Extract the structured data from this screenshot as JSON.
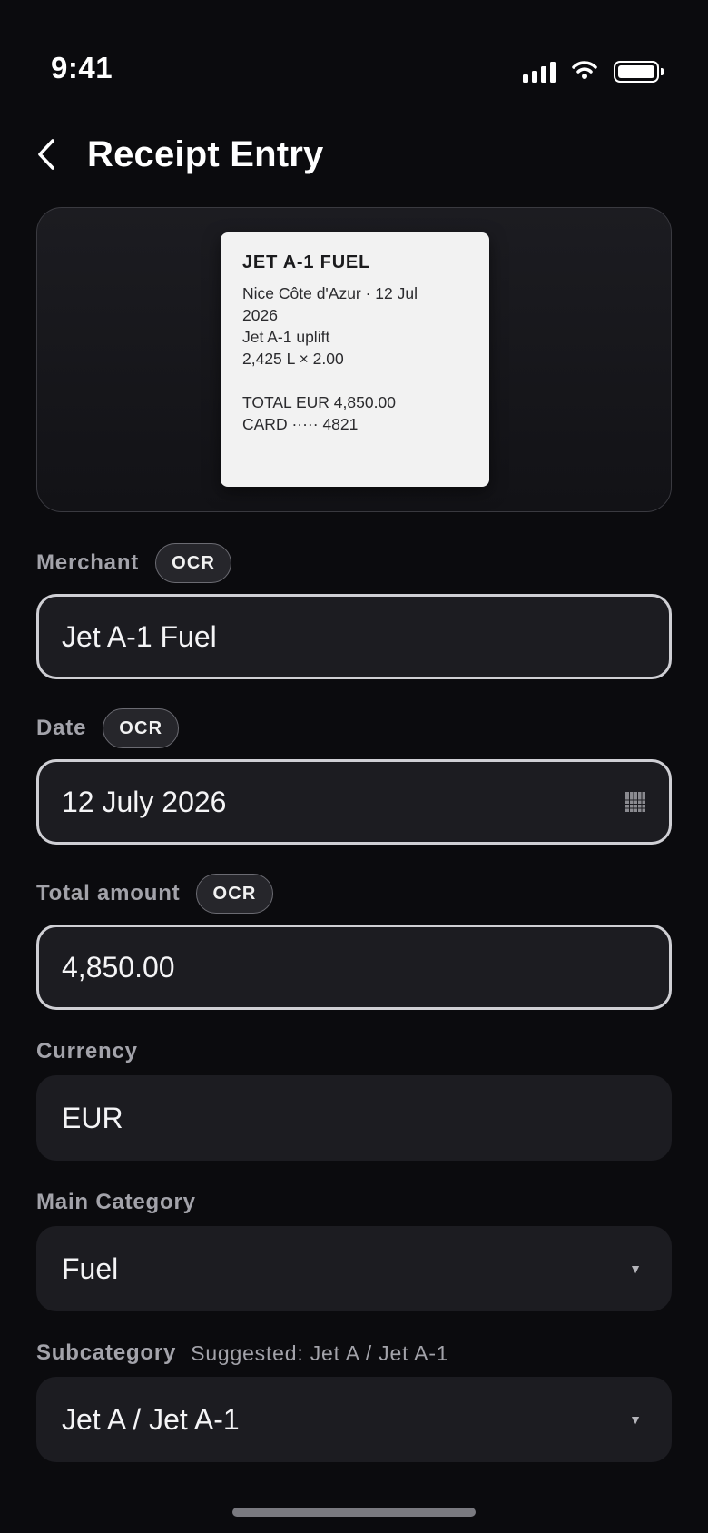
{
  "status_bar": {
    "time": "9:41"
  },
  "header": {
    "title": "Receipt Entry"
  },
  "receipt": {
    "title": "JET A-1 FUEL",
    "lines_top": [
      "Nice Côte d'Azur · 12 Jul",
      "2026",
      "Jet A-1 uplift",
      "2,425 L × 2.00"
    ],
    "lines_bottom": [
      "TOTAL EUR 4,850.00",
      "CARD ····· 4821"
    ]
  },
  "fields": {
    "merchant": {
      "label": "Merchant",
      "badge": "OCR",
      "value": "Jet A-1 Fuel"
    },
    "date": {
      "label": "Date",
      "badge": "OCR",
      "value": "12 July 2026",
      "icon": "calendar-icon"
    },
    "total": {
      "label": "Total amount",
      "badge": "OCR",
      "value": "4,850.00"
    },
    "currency": {
      "label": "Currency",
      "value": "EUR"
    },
    "main_category": {
      "label": "Main Category",
      "value": "Fuel",
      "icon": "chevron-down-icon"
    },
    "subcategory": {
      "label": "Subcategory",
      "suggestion": "Suggested: Jet A / Jet A-1",
      "value": "Jet A / Jet A-1",
      "icon": "chevron-down-icon"
    }
  },
  "colors": {
    "background": "#0b0b0e",
    "field_bg": "#1c1c21",
    "label": "#a3a3aa",
    "outline": "#cfcfd4"
  }
}
